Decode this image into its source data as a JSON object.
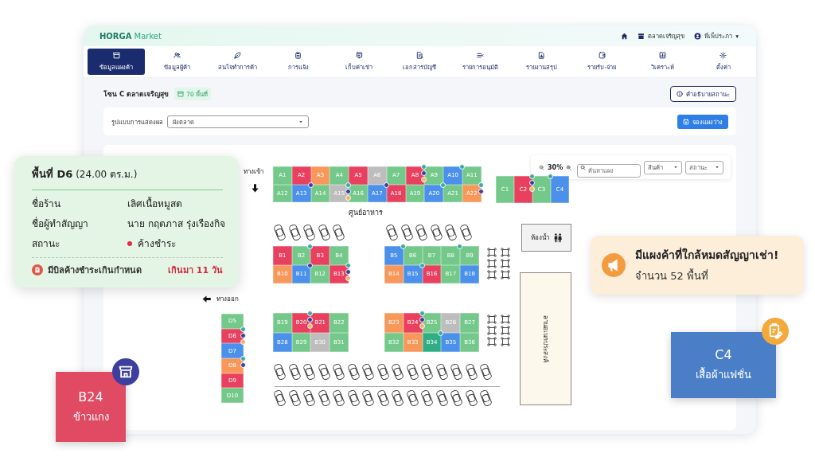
{
  "header": {
    "logo_brand": "HORGA",
    "logo_suffix": "Market",
    "market": "ตลาดเจริญสุข",
    "user": "พี่เพ็ประภา",
    "user_caret": "▾"
  },
  "nav": [
    {
      "label": "ข้อมูลแผงค้า",
      "selected": true
    },
    {
      "label": "ข้อมูลผู้ค้า",
      "selected": false
    },
    {
      "label": "สนใจทำการค้า",
      "selected": false
    },
    {
      "label": "การแจ้ง",
      "selected": false
    },
    {
      "label": "เก็บค่าเช่า",
      "selected": false
    },
    {
      "label": "เอกสารบัญชี",
      "selected": false
    },
    {
      "label": "รายการอนุมัติ",
      "selected": false
    },
    {
      "label": "รายงานสรุป",
      "selected": false
    },
    {
      "label": "รายรับ-จ่าย",
      "selected": false
    },
    {
      "label": "วิเคราะห์",
      "selected": false
    },
    {
      "label": "ตั้งค่า",
      "selected": false
    }
  ],
  "zone": {
    "title": "โซน C ตลาดเจริญสุข",
    "badge": "70 พื้นที่",
    "legend_button": "คำอธิบายสถานะ"
  },
  "filter": {
    "label": "รูปแบบการแสดงผล",
    "view_select": "ผังตลาด",
    "book_button": "จองแผงว่าง"
  },
  "map": {
    "zoom": "30%",
    "search_placeholder": "ค้นหาแผง",
    "product_filter": "สินค้า",
    "status_filter": "สถานะ",
    "labels": {
      "entrance": "ทางเข้า",
      "food_court": "ศูนย์อาหาร",
      "exit": "ทางออก",
      "restroom": "ห้องน้ำ",
      "plaza": "ลานอเนกประสงค์"
    },
    "stall_blocks": [
      {
        "rows": [
          [
            {
              "label": "A1",
              "color": "#74c98a"
            },
            {
              "label": "A2",
              "color": "#e8405e"
            },
            {
              "label": "A3",
              "color": "#f7975a"
            },
            {
              "label": "A4",
              "color": "#74c98a"
            },
            {
              "label": "A5",
              "color": "#e8405e"
            },
            {
              "label": "A6",
              "color": "#bdbdbd"
            },
            {
              "label": "A7",
              "color": "#74c98a"
            },
            {
              "label": "A8",
              "color": "#e8405e",
              "marks": [
                {
                  "color": "#3aa9a8"
                },
                {
                  "color": "#3d3f9f"
                },
                {
                  "color": "#f5b26b"
                }
              ]
            },
            {
              "label": "A9",
              "color": "#74c98a"
            },
            {
              "label": "A10",
              "color": "#4b90ea",
              "marks": [
                {
                  "color": "#3aa9a8"
                }
              ]
            },
            {
              "label": "A11",
              "color": "#74c98a"
            }
          ],
          [
            {
              "label": "A12",
              "color": "#74c98a"
            },
            {
              "label": "A13",
              "color": "#4b90ea",
              "marks": [
                {
                  "color": "#3d3f9f"
                }
              ]
            },
            {
              "label": "A14",
              "color": "#74c98a"
            },
            {
              "label": "A15",
              "color": "#bdbdbd",
              "marks": [
                {
                  "color": "#3aa9a8"
                },
                {
                  "color": "#3d3f9f"
                },
                {
                  "color": "#f5b26b"
                }
              ]
            },
            {
              "label": "A16",
              "color": "#74c98a"
            },
            {
              "label": "A17",
              "color": "#4b90ea",
              "marks": [
                {
                  "color": "#3d3f9f"
                }
              ]
            },
            {
              "label": "A18",
              "color": "#e8405e"
            },
            {
              "label": "A19",
              "color": "#74c98a"
            },
            {
              "label": "A20",
              "color": "#4b90ea",
              "marks": [
                {
                  "color": "#3aa9a8"
                }
              ]
            },
            {
              "label": "A21",
              "color": "#74c98a"
            },
            {
              "label": "A22",
              "color": "#f7975a",
              "marks": [
                {
                  "color": "#3aa9a8"
                },
                {
                  "color": "#3d3f9f"
                }
              ]
            }
          ]
        ]
      },
      {
        "rows": [
          [
            {
              "label": "C1",
              "color": "#74c98a"
            },
            {
              "label": "C2",
              "color": "#e8405e",
              "marks": [
                {
                  "color": "#3aa9a8"
                },
                {
                  "color": "#3d3f9f"
                },
                {
                  "color": "#f5b26b"
                }
              ]
            },
            {
              "label": "C3",
              "color": "#74c98a",
              "marks": [
                {
                  "color": "#3aa9a8"
                }
              ]
            },
            {
              "label": "C4",
              "color": "#4b90ea"
            }
          ]
        ]
      },
      {
        "rows": [
          [
            {
              "label": "B1",
              "color": "#e8405e"
            },
            {
              "label": "B2",
              "color": "#74c98a",
              "marks": [
                {
                  "color": "#3aa9a8"
                }
              ]
            },
            {
              "label": "B3",
              "color": "#e8405e"
            },
            {
              "label": "B4",
              "color": "#74c98a"
            }
          ],
          [
            {
              "label": "B10",
              "color": "#f7975a"
            },
            {
              "label": "B11",
              "color": "#4b90ea",
              "marks": [
                {
                  "color": "#3d3f9f"
                }
              ]
            },
            {
              "label": "B12",
              "color": "#74c98a"
            },
            {
              "label": "B13",
              "color": "#e8405e",
              "marks": [
                {
                  "color": "#3aa9a8"
                },
                {
                  "color": "#3d3f9f"
                },
                {
                  "color": "#f5b26b"
                }
              ]
            }
          ]
        ]
      },
      {
        "rows": [
          [
            {
              "label": "B5",
              "color": "#4b90ea",
              "marks": [
                {
                  "color": "#3aa9a8"
                }
              ]
            },
            {
              "label": "B6",
              "color": "#74c98a"
            },
            {
              "label": "B7",
              "color": "#74c98a"
            },
            {
              "label": "B8",
              "color": "#74c98a",
              "marks": [
                {
                  "color": "#3aa9a8"
                }
              ]
            },
            {
              "label": "B9",
              "color": "#74c98a"
            }
          ],
          [
            {
              "label": "B14",
              "color": "#f7975a"
            },
            {
              "label": "B15",
              "color": "#4b90ea",
              "marks": [
                {
                  "color": "#3aa9a8"
                }
              ]
            },
            {
              "label": "B16",
              "color": "#e8405e"
            },
            {
              "label": "B17",
              "color": "#74c98a"
            },
            {
              "label": "B18",
              "color": "#4b90ea"
            }
          ]
        ]
      },
      {
        "rows": [
          [
            {
              "label": "D5",
              "color": "#74c98a"
            }
          ],
          [
            {
              "label": "D6",
              "color": "#e8405e",
              "marks": [
                {
                  "color": "#3aa9a8"
                },
                {
                  "color": "#3d3f9f"
                },
                {
                  "color": "#f5b26b"
                }
              ]
            }
          ],
          [
            {
              "label": "D7",
              "color": "#4b90ea"
            }
          ],
          [
            {
              "label": "D8",
              "color": "#f7975a",
              "marks": [
                {
                  "color": "#3aa9a8"
                },
                {
                  "color": "#3d3f9f"
                }
              ]
            }
          ],
          [
            {
              "label": "D9",
              "color": "#e8405e"
            }
          ],
          [
            {
              "label": "D10",
              "color": "#74c98a"
            }
          ]
        ]
      },
      {
        "rows": [
          [
            {
              "label": "B19",
              "color": "#74c98a"
            },
            {
              "label": "B20",
              "color": "#e8405e",
              "marks": [
                {
                  "color": "#3aa9a8"
                },
                {
                  "color": "#3d3f9f"
                },
                {
                  "color": "#f5b26b"
                }
              ]
            },
            {
              "label": "B21",
              "color": "#e8405e"
            },
            {
              "label": "B22",
              "color": "#74c98a"
            }
          ],
          [
            {
              "label": "B28",
              "color": "#4b90ea"
            },
            {
              "label": "B29",
              "color": "#74c98a"
            },
            {
              "label": "B30",
              "color": "#bdbdbd"
            },
            {
              "label": "B31",
              "color": "#74c98a"
            }
          ]
        ]
      },
      {
        "rows": [
          [
            {
              "label": "B23",
              "color": "#f7975a"
            },
            {
              "label": "B24",
              "color": "#e8405e",
              "marks": [
                {
                  "color": "#3aa9a8"
                },
                {
                  "color": "#3d3f9f"
                },
                {
                  "color": "#f5b26b"
                }
              ]
            },
            {
              "label": "B25",
              "color": "#74c98a"
            },
            {
              "label": "B26",
              "color": "#bdbdbd"
            },
            {
              "label": "B27",
              "color": "#74c98a"
            }
          ],
          [
            {
              "label": "B32",
              "color": "#74c98a"
            },
            {
              "label": "B33",
              "color": "#f7975a"
            },
            {
              "label": "B34",
              "color": "#2fae84",
              "marks": [
                {
                  "color": "#3aa9a8"
                }
              ]
            },
            {
              "label": "B35",
              "color": "#4b90ea"
            },
            {
              "label": "B36",
              "color": "#74c98a"
            }
          ]
        ]
      }
    ]
  },
  "stall_tooltip": {
    "title": "**พื้นที่ D6** (24.00 ตร.ม.)",
    "fields": [
      {
        "label": "ชื่อร้าน",
        "value": "เลิศเนื้อหมูสด"
      },
      {
        "label": "ชื่อผู้ทำสัญญา",
        "value": "นาย กฤตภาส รุ่งเรืองกิจ"
      },
      {
        "label": "สถานะ",
        "value": "ค้างชำระ",
        "color": "#e8293f"
      }
    ],
    "warning": "มีบิลค้างชำระเกินกำหนด",
    "overdue": "เกินมา 11 วัน"
  },
  "alert": {
    "title": "มีแผงค้าที่ใกล้หมดสัญญาเช่า!",
    "text": "จำนวน 52 พื้นที่"
  },
  "callouts": [
    {
      "code": "C4",
      "name": "เสื้อผ้าแฟชั่น",
      "color": "#4a7fc7"
    },
    {
      "code": "B24",
      "name": "ข้าวแกง",
      "color": "#e14a63"
    }
  ]
}
